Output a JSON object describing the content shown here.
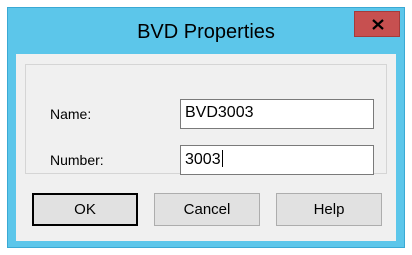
{
  "window": {
    "title": "BVD Properties",
    "close_label": "x"
  },
  "form": {
    "name_label": "Name:",
    "name_value": "BVD3003",
    "number_label": "Number:",
    "number_value": "3003"
  },
  "buttons": {
    "ok": "OK",
    "cancel": "Cancel",
    "help": "Help"
  },
  "colors": {
    "titlebar": "#5cc6ea",
    "close_button": "#c75050",
    "client_background": "#f0f0f0"
  }
}
